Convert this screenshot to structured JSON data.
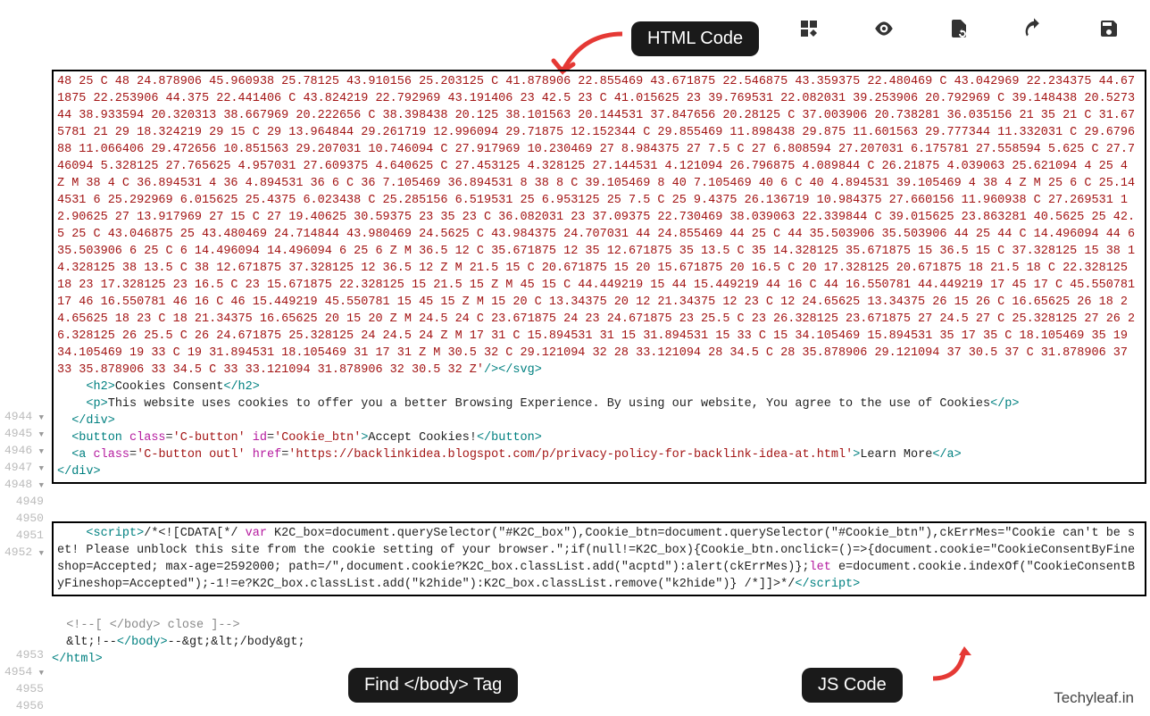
{
  "toolbar": {
    "icons": [
      "grid-icon",
      "visibility-icon",
      "restore-icon",
      "undo-icon",
      "save-icon"
    ]
  },
  "labels": {
    "html_code": "HTML Code",
    "find_body": "Find </body> Tag",
    "js_code": "JS Code"
  },
  "watermark": "Techyleaf.in",
  "gutter": {
    "block1_start": 4944,
    "block1_end": 4951,
    "block2_line": 4952,
    "block3_start": 4953,
    "block3_end": 4956
  },
  "code": {
    "svg_path": "48 25 C 48 24.878906 45.960938 25.78125 43.910156 25.203125 C 41.878906 22.855469 43.671875 22.546875 43.359375 22.480469 C 43.042969 22.234375 44.671875 22.253906 44.375 22.441406 C 43.824219 22.792969 43.191406 23 42.5 23 C 41.015625 23 39.769531 22.082031 39.253906 20.792969 C 39.148438 20.527344 38.933594 20.320313 38.667969 20.222656 C 38.398438 20.125 38.101563 20.144531 37.847656 20.28125 C 37.003906 20.738281 36.035156 21 35 21 C 31.675781 21 29 18.324219 29 15 C 29 13.964844 29.261719 12.996094 29.71875 12.152344 C 29.855469 11.898438 29.875 11.601563 29.777344 11.332031 C 29.679688 11.066406 29.472656 10.851563 29.207031 10.746094 C 27.917969 10.230469 27 8.984375 27 7.5 C 27 6.808594 27.207031 6.175781 27.558594 5.625 C 27.746094 5.328125 27.765625 4.957031 27.609375 4.640625 C 27.453125 4.328125 27.144531 4.121094 26.796875 4.089844 C 26.21875 4.039063 25.621094 4 25 4 Z M 38 4 C 36.894531 4 36 4.894531 36 6 C 36 7.105469 36.894531 8 38 8 C 39.105469 8 40 7.105469 40 6 C 40 4.894531 39.105469 4 38 4 Z M 25 6 C 25.144531 6 25.292969 6.015625 25.4375 6.023438 C 25.285156 6.519531 25 6.953125 25 7.5 C 25 9.4375 26.136719 10.984375 27.660156 11.960938 C 27.269531 12.90625 27 13.917969 27 15 C 27 19.40625 30.59375 23 35 23 C 36.082031 23 37.09375 22.730469 38.039063 22.339844 C 39.015625 23.863281 40.5625 25 42.5 25 C 43.046875 25 43.480469 24.714844 43.980469 24.5625 C 43.984375 24.707031 44 24.855469 44 25 C 44 35.503906 35.503906 44 25 44 C 14.496094 44 6 35.503906 6 25 C 6 14.496094 14.496094 6 25 6 Z M 36.5 12 C 35.671875 12 35 12.671875 35 13.5 C 35 14.328125 35.671875 15 36.5 15 C 37.328125 15 38 14.328125 38 13.5 C 38 12.671875 37.328125 12 36.5 12 Z M 21.5 15 C 20.671875 15 20 15.671875 20 16.5 C 20 17.328125 20.671875 18 21.5 18 C 22.328125 18 23 17.328125 23 16.5 C 23 15.671875 22.328125 15 21.5 15 Z M 45 15 C 44.449219 15 44 15.449219 44 16 C 44 16.550781 44.449219 17 45 17 C 45.550781 17 46 16.550781 46 16 C 46 15.449219 45.550781 15 45 15 Z M 15 20 C 13.34375 20 12 21.34375 12 23 C 12 24.65625 13.34375 26 15 26 C 16.65625 26 18 24.65625 18 23 C 18 21.34375 16.65625 20 15 20 Z M 24.5 24 C 23.671875 24 23 24.671875 23 25.5 C 23 26.328125 23.671875 27 24.5 27 C 25.328125 27 26 26.328125 26 25.5 C 26 24.671875 25.328125 24 24.5 24 Z M 17 31 C 15.894531 31 15 31.894531 15 33 C 15 34.105469 15.894531 35 17 35 C 18.105469 35 19 34.105469 19 33 C 19 31.894531 18.105469 31 17 31 Z M 30.5 32 C 29.121094 32 28 33.121094 28 34.5 C 28 35.878906 29.121094 37 30.5 37 C 31.878906 37 33 35.878906 33 34.5 C 33 33.121094 31.878906 32 30.5 32 Z'",
    "line4944": "    <h2>Cookies Consent</h2>",
    "line4945": "    <p>This website uses cookies to offer you a better Browsing Experience. By using our website, You agree to the use of Cookies</p>",
    "line4946": "  </div>",
    "line4947": "  <button class='C-button' id='Cookie_btn'>Accept Cookies!</button>",
    "line4948": "  <a class='C-button outl' href='https://backlinkidea.blogspot.com/p/privacy-policy-for-backlink-idea-at.html'>Learn More</a>",
    "line4949": "</div>",
    "js_block": "    <script>/*<![CDATA[*/ var K2C_box=document.querySelector(\"#K2C_box\"),Cookie_btn=document.querySelector(\"#Cookie_btn\"),ckErrMes=\"Cookie can't be set! Please unblock this site from the cookie setting of your browser.\";if(null!=K2C_box){Cookie_btn.onclick=()=>{document.cookie=\"CookieConsentByFineshop=Accepted; max-age=2592000; path=/\",document.cookie?K2C_box.classList.add(\"acptd\"):alert(ckErrMes)};let e=document.cookie.indexOf(\"CookieConsentByFineshop=Accepted\");-1!=e?K2C_box.classList.add(\"k2hide\"):K2C_box.classList.remove(\"k2hide\")} /*]]>*/</script>",
    "line4954": "  <!--[ </body> close ]-->",
    "line4955": "  &lt;!--</body>--&gt;&lt;/body&gt;",
    "line4956": "</html>"
  }
}
